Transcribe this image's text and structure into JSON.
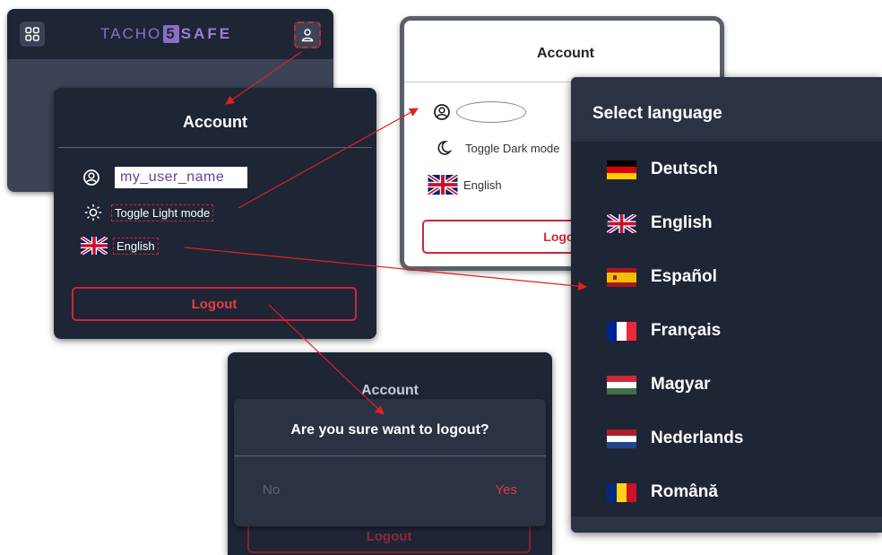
{
  "app": {
    "logo_prefix": "TACHO",
    "logo_number": "5",
    "logo_suffix": "SAFE"
  },
  "dark_account": {
    "title": "Account",
    "username": "my_user_name",
    "toggle_label": "Toggle Light mode",
    "language": "English",
    "logout": "Logout"
  },
  "light_account": {
    "title": "Account",
    "toggle_label": "Toggle Dark mode",
    "language": "English",
    "logout": "Logout"
  },
  "language_select": {
    "title": "Select language",
    "options": [
      {
        "label": "Deutsch",
        "flag": "de-flag-icon"
      },
      {
        "label": "English",
        "flag": "uk-flag-icon"
      },
      {
        "label": "Español",
        "flag": "es-flag-icon"
      },
      {
        "label": "Français",
        "flag": "fr-flag-icon"
      },
      {
        "label": "Magyar",
        "flag": "hu-flag-icon"
      },
      {
        "label": "Nederlands",
        "flag": "nl-flag-icon"
      },
      {
        "label": "Română",
        "flag": "ro-flag-icon"
      }
    ]
  },
  "logout_confirm": {
    "bg_title": "Account",
    "question": "Are you sure want to logout?",
    "no": "No",
    "yes": "Yes",
    "bg_logout": "Logout"
  },
  "colors": {
    "dark_bg": "#1e2535",
    "accent_red": "#d0253a",
    "logo_purple": "#8a6fc7"
  }
}
